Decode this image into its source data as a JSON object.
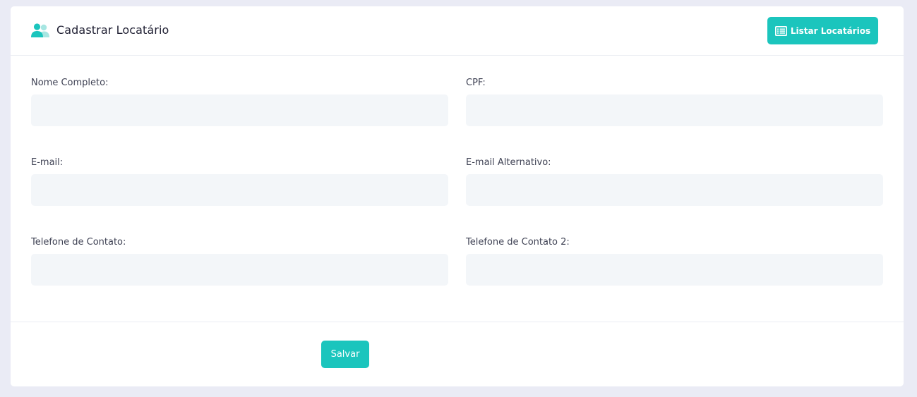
{
  "header": {
    "icon": "users-icon",
    "title": "Cadastrar Locatário",
    "list_button": {
      "icon": "list-icon",
      "label": "Listar Locatários"
    }
  },
  "form": {
    "fields": [
      {
        "label": "Nome Completo:",
        "value": "",
        "placeholder": ""
      },
      {
        "label": "CPF:",
        "value": "",
        "placeholder": ""
      },
      {
        "label": "E-mail:",
        "value": "",
        "placeholder": ""
      },
      {
        "label": "E-mail Alternativo:",
        "value": "",
        "placeholder": ""
      },
      {
        "label": "Telefone de Contato:",
        "value": "",
        "placeholder": ""
      },
      {
        "label": "Telefone de Contato 2:",
        "value": "",
        "placeholder": ""
      }
    ]
  },
  "footer": {
    "save_label": "Salvar"
  },
  "colors": {
    "accent": "#1bc5bd",
    "page_background": "#eaebf5",
    "input_background": "#f3f6f9",
    "icon_primary": "#1bc5bd",
    "icon_secondary": "#a7e6e2"
  }
}
